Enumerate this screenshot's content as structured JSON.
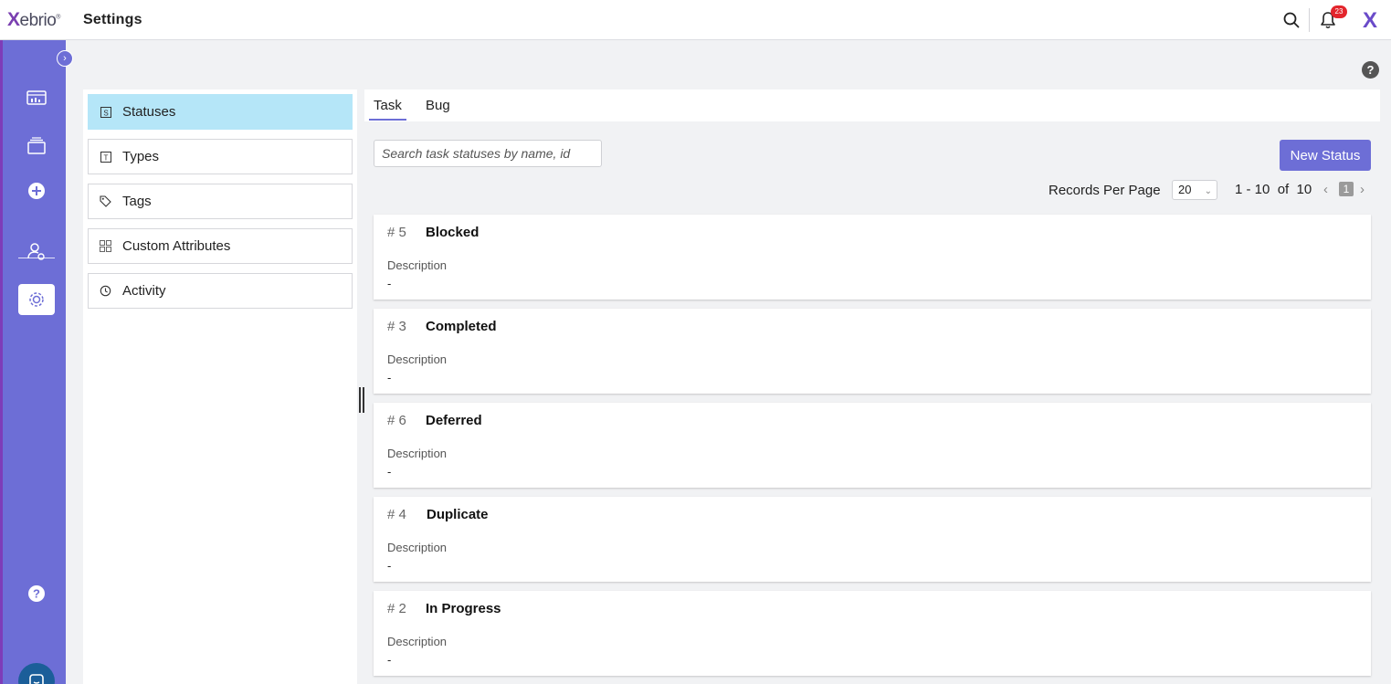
{
  "app": {
    "logo": "Xebrio",
    "page_title": "Settings",
    "notification_count": "23",
    "help_glyph": "?"
  },
  "colors": {
    "accent": "#6d6ed6",
    "rail": "#6d6ed6",
    "active_nav": "#b5e6f8",
    "badge": "#e3252c",
    "chat": "#1b5e99"
  },
  "rail": {
    "items": [
      {
        "icon": "dashboard-icon"
      },
      {
        "icon": "stack-icon"
      },
      {
        "icon": "plus-circle-icon"
      },
      {
        "icon": "user-settings-icon"
      },
      {
        "icon": "gear-icon",
        "active": true
      }
    ],
    "help_icon": "help-icon",
    "chat_icon": "chat-icon"
  },
  "settings_nav": {
    "items": [
      {
        "label": "Statuses",
        "icon": "statuses-icon",
        "active": true
      },
      {
        "label": "Types",
        "icon": "types-icon"
      },
      {
        "label": "Tags",
        "icon": "tag-icon"
      },
      {
        "label": "Custom Attributes",
        "icon": "grid-icon"
      },
      {
        "label": "Activity",
        "icon": "history-icon"
      }
    ]
  },
  "tabs": [
    {
      "label": "Task",
      "active": true
    },
    {
      "label": "Bug"
    }
  ],
  "search": {
    "placeholder": "Search task statuses by name, id",
    "value": ""
  },
  "toolbar": {
    "new_status_label": "New Status"
  },
  "pagination": {
    "records_per_page_label": "Records Per Page",
    "records_per_page_value": "20",
    "range_text": "1 - 10  of  10",
    "current_page": "1"
  },
  "statuses": [
    {
      "id": "# 5",
      "name": "Blocked",
      "description_label": "Description",
      "description": "-"
    },
    {
      "id": "# 3",
      "name": "Completed",
      "description_label": "Description",
      "description": "-"
    },
    {
      "id": "# 6",
      "name": "Deferred",
      "description_label": "Description",
      "description": "-"
    },
    {
      "id": "# 4",
      "name": "Duplicate",
      "description_label": "Description",
      "description": "-"
    },
    {
      "id": "# 2",
      "name": "In Progress",
      "description_label": "Description",
      "description": "-"
    }
  ]
}
